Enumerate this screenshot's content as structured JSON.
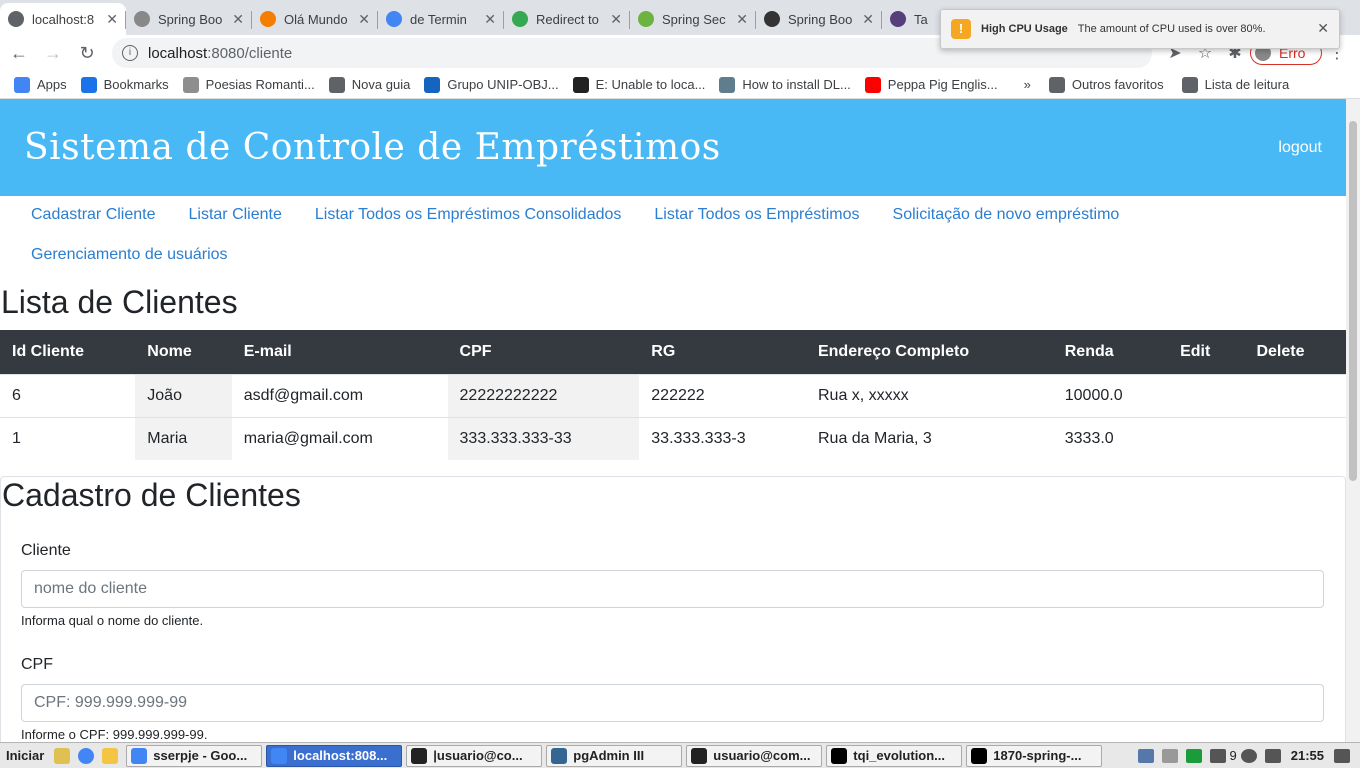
{
  "browser": {
    "tabs": [
      {
        "label": "localhost:8",
        "color": "#5f6368",
        "active": true
      },
      {
        "label": "Spring Boo",
        "color": "#888888"
      },
      {
        "label": "Olá Mundo",
        "color": "#f57d00"
      },
      {
        "label": "de Termin",
        "color": "#4285f4"
      },
      {
        "label": "Redirect to",
        "color": "#34a853"
      },
      {
        "label": "Spring Sec",
        "color": "#6db33f"
      },
      {
        "label": "Spring Boo",
        "color": "#333333"
      },
      {
        "label": "Ta",
        "color": "#563d7c"
      }
    ],
    "url_host": "localhost",
    "url_rest": ":8080/cliente",
    "profile_label": "Erro",
    "bookmarks": [
      {
        "label": "Apps",
        "color": "#4285f4"
      },
      {
        "label": "Bookmarks",
        "color": "#1a73e8"
      },
      {
        "label": "Poesias Romanti...",
        "color": "#8e8e8e"
      },
      {
        "label": "Nova guia",
        "color": "#5f6368"
      },
      {
        "label": "Grupo UNIP-OBJ...",
        "color": "#1565c0"
      },
      {
        "label": "E: Unable to loca...",
        "color": "#222222"
      },
      {
        "label": "How to install DL...",
        "color": "#607d8b"
      },
      {
        "label": "Peppa Pig Englis...",
        "color": "#ff0000"
      }
    ],
    "bookmarks_more": "»",
    "other_favorites": "Outros favoritos",
    "reading_list": "Lista de leitura"
  },
  "notification": {
    "title": "High CPU Usage",
    "message": "The amount of CPU used is over 80%.",
    "close": "✕"
  },
  "app": {
    "title": "Sistema de Controle de Empréstimos",
    "logout": "logout",
    "menu": [
      "Cadastrar Cliente",
      "Listar Cliente",
      "Listar Todos os Empréstimos Consolidados",
      "Listar Todos os Empréstimos",
      "Solicitação de novo empréstimo",
      "Gerenciamento de usuários"
    ],
    "list_title": "Lista de Clientes",
    "table": {
      "headers": [
        "Id Cliente",
        "Nome",
        "E-mail",
        "CPF",
        "RG",
        "Endereço Completo",
        "Renda",
        "Edit",
        "Delete"
      ],
      "rows": [
        [
          "6",
          "João",
          "asdf@gmail.com",
          "22222222222",
          "222222",
          "Rua x, xxxxx",
          "10000.0",
          "",
          ""
        ],
        [
          "1",
          "Maria",
          "maria@gmail.com",
          "333.333.333-33",
          "33.333.333-3",
          "Rua da Maria, 3",
          "3333.0",
          "",
          ""
        ]
      ]
    },
    "form_title": "Cadastro de Clientes",
    "fields": [
      {
        "label": "Cliente",
        "placeholder": "nome do cliente",
        "help": "Informa qual o nome do cliente."
      },
      {
        "label": "CPF",
        "placeholder": "CPF: 999.999.999-99",
        "help": "Informe o CPF: 999.999.999-99."
      }
    ]
  },
  "taskbar": {
    "start": "Iniciar",
    "tasks": [
      {
        "label": "sserpje - Goo...",
        "color": "#4285f4",
        "active": false
      },
      {
        "label": "localhost:808...",
        "color": "#4285f4",
        "active": true
      },
      {
        "label": "|usuario@co...",
        "color": "#222222",
        "active": false
      },
      {
        "label": "pgAdmin III",
        "color": "#336791",
        "active": false
      },
      {
        "label": "usuario@com...",
        "color": "#222222",
        "active": false
      },
      {
        "label": "tqi_evolution...",
        "color": "#000000",
        "active": false
      },
      {
        "label": "1870-spring-...",
        "color": "#000000",
        "active": false
      }
    ],
    "tray_count": "9",
    "clock": "21:55"
  }
}
